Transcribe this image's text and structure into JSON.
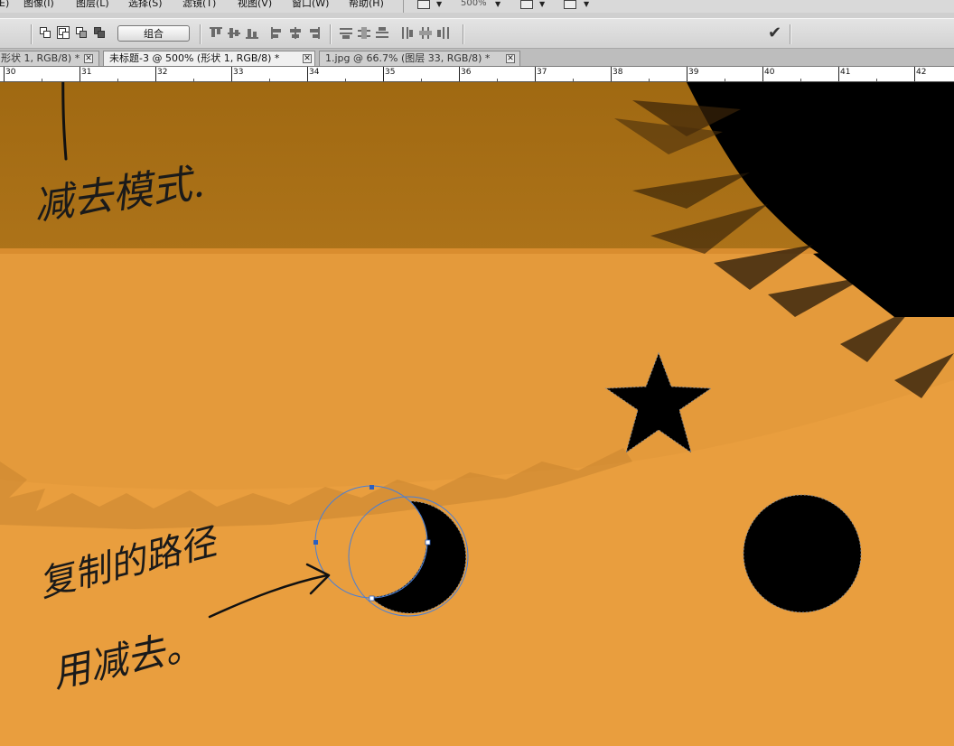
{
  "menu": {
    "items": [
      "E)",
      "图像(I)",
      "图层(L)",
      "选择(S)",
      "滤镜(T)",
      "视图(V)",
      "窗口(W)",
      "帮助(H)"
    ],
    "zoom": "500%"
  },
  "options": {
    "combine_label": "组合",
    "commit_glyph": "✔"
  },
  "tabs": [
    {
      "label": "形状 1, RGB/8) *",
      "close": "✕"
    },
    {
      "label": "未标题-3 @ 500% (形状 1, RGB/8) *",
      "close": "✕"
    },
    {
      "label": "1.jpg @ 66.7% (图层 33, RGB/8) *",
      "close": "✕"
    }
  ],
  "ruler": {
    "labels": [
      "30",
      "31",
      "32",
      "33",
      "34",
      "35",
      "36",
      "37",
      "38",
      "39",
      "40",
      "41",
      "42"
    ]
  },
  "annotations": {
    "subtract_mode": "减去模式.",
    "copied_path": "复制的路径",
    "use_subtract": "用减去。"
  },
  "colors": {
    "canvas_upper": "#a86e16",
    "canvas_lower": "#e99e3e",
    "path_stroke": "#4a7fd6",
    "shape_fill": "#000000"
  },
  "icons": [
    "new-layer-icon",
    "subtract-icon",
    "intersect-icon",
    "exclude-icon",
    "commit-checkmark-icon",
    "close-icon"
  ]
}
